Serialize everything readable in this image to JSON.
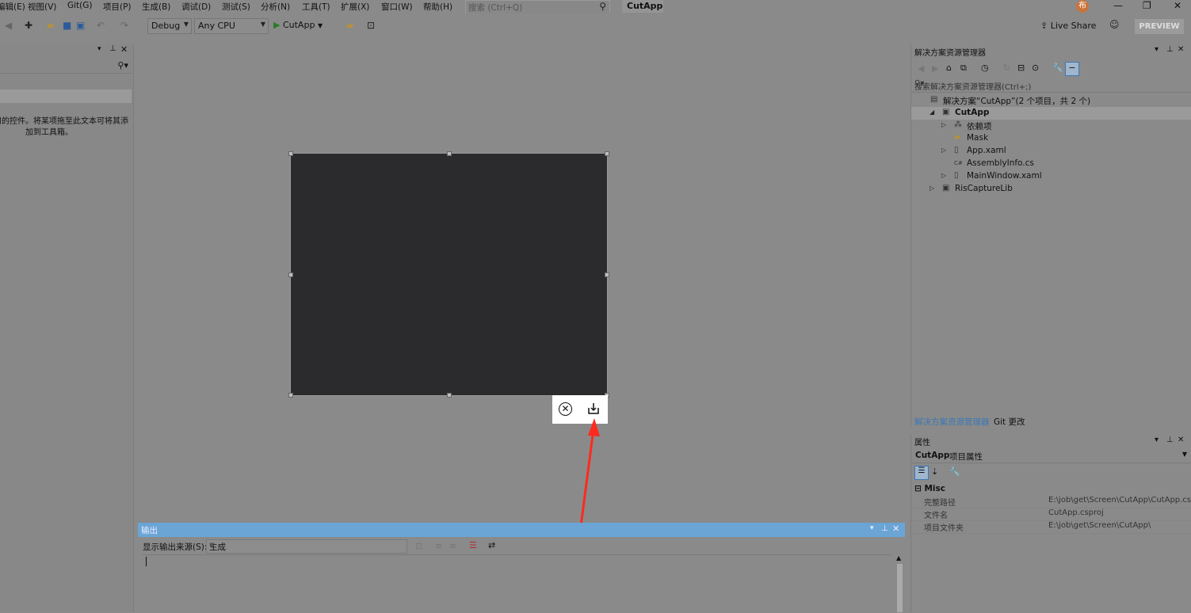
{
  "menu": {
    "items": [
      "编辑(E)",
      "视图(V)",
      "Git(G)",
      "项目(P)",
      "生成(B)",
      "调试(D)",
      "测试(S)",
      "分析(N)",
      "工具(T)",
      "扩展(X)",
      "窗口(W)",
      "帮助(H)"
    ],
    "search_placeholder": "搜索 (Ctrl+Q)",
    "app_title": "CutApp",
    "avatar_initial": "布"
  },
  "toolbar": {
    "config": "Debug",
    "platform": "Any CPU",
    "run_target": "CutApp",
    "live_share": "Live Share",
    "preview": "PREVIEW"
  },
  "toolbox": {
    "message": "没有可用的控件。将某项拖至此文本可将其添加到工具箱。"
  },
  "solution_explorer": {
    "title": "解决方案资源管理器",
    "search_placeholder": "搜索解决方案资源管理器(Ctrl+;)",
    "tree": [
      {
        "label": "解决方案“CutApp”(2 个项目，共 2 个)",
        "icon": "solution-icon",
        "depth": 0,
        "expander": ""
      },
      {
        "label": "CutApp",
        "icon": "csharp-project-icon",
        "depth": 1,
        "expander": "◢",
        "bold": true,
        "selected": true
      },
      {
        "label": "依赖项",
        "icon": "dependencies-icon",
        "depth": 2,
        "expander": "▷"
      },
      {
        "label": "Mask",
        "icon": "folder-icon",
        "depth": 2,
        "expander": ""
      },
      {
        "label": "App.xaml",
        "icon": "xaml-file-icon",
        "depth": 2,
        "expander": "▷"
      },
      {
        "label": "AssemblyInfo.cs",
        "icon": "csharp-file-icon",
        "depth": 2,
        "expander": ""
      },
      {
        "label": "MainWindow.xaml",
        "icon": "xaml-file-icon",
        "depth": 2,
        "expander": "▷"
      },
      {
        "label": "RisCaptureLib",
        "icon": "csharp-project-icon",
        "depth": 1,
        "expander": "▷"
      }
    ],
    "tabs": [
      "解决方案资源管理器",
      "Git 更改"
    ]
  },
  "properties": {
    "title": "属性",
    "object_name": "CutApp",
    "object_type": "项目属性",
    "category": "Misc",
    "rows": [
      {
        "key": "完整路径",
        "value": "E:\\job\\get\\Screen\\CutApp\\CutApp.cs"
      },
      {
        "key": "文件名",
        "value": "CutApp.csproj"
      },
      {
        "key": "项目文件夹",
        "value": "E:\\job\\get\\Screen\\CutApp\\"
      }
    ]
  },
  "output": {
    "title": "输出",
    "source_label": "显示输出来源(S):",
    "source_value": "生成"
  },
  "colors": {
    "window_preview": "#2b2b2d",
    "output_title_bar": "#6aa5d6",
    "annotation_arrow": "#ff2a1f"
  }
}
